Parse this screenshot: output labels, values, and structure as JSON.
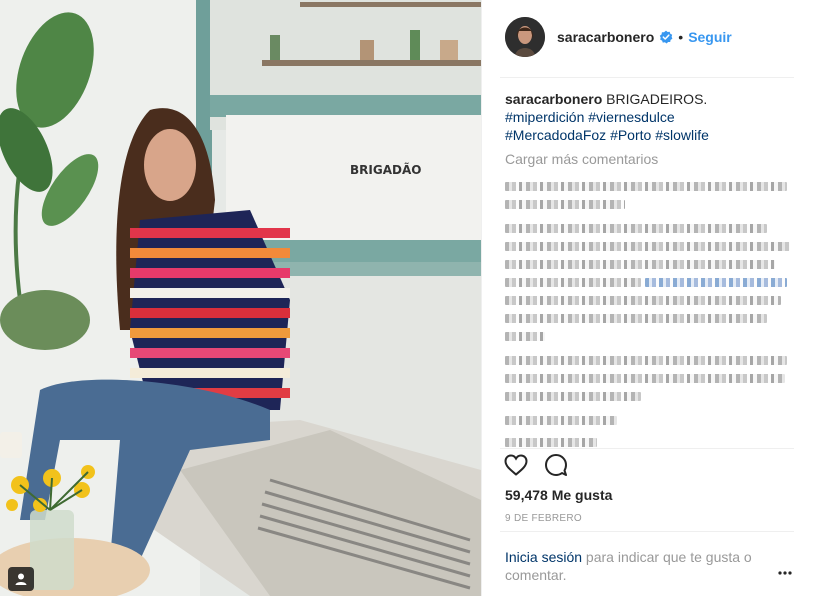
{
  "post": {
    "username": "saracarbonero",
    "follow_label": "Seguir",
    "dot": "•",
    "caption": {
      "user": "saracarbonero",
      "text": "BRIGADEIROS.",
      "hashtags_line1": [
        "#miperdición",
        "#viernesdulce"
      ],
      "hashtags_line2": [
        "#MercadodaFoz",
        "#Porto",
        "#slowlife"
      ]
    },
    "load_more": "Cargar más comentarios",
    "likes": "59,478 Me gusta",
    "date": "9 DE FEBRERO",
    "login_link": "Inicia sesión",
    "login_text": " para indicar que te gusta o comentar.",
    "photo_sign": "BRIGADÃO"
  },
  "icons": {
    "verified": "verified-badge-icon",
    "like": "heart-icon",
    "comment": "comment-bubble-icon",
    "more": "more-options-icon",
    "tag": "user-tag-icon"
  },
  "colors": {
    "accent": "#3897f0",
    "link": "#003569",
    "muted": "#999999",
    "text": "#262626"
  }
}
